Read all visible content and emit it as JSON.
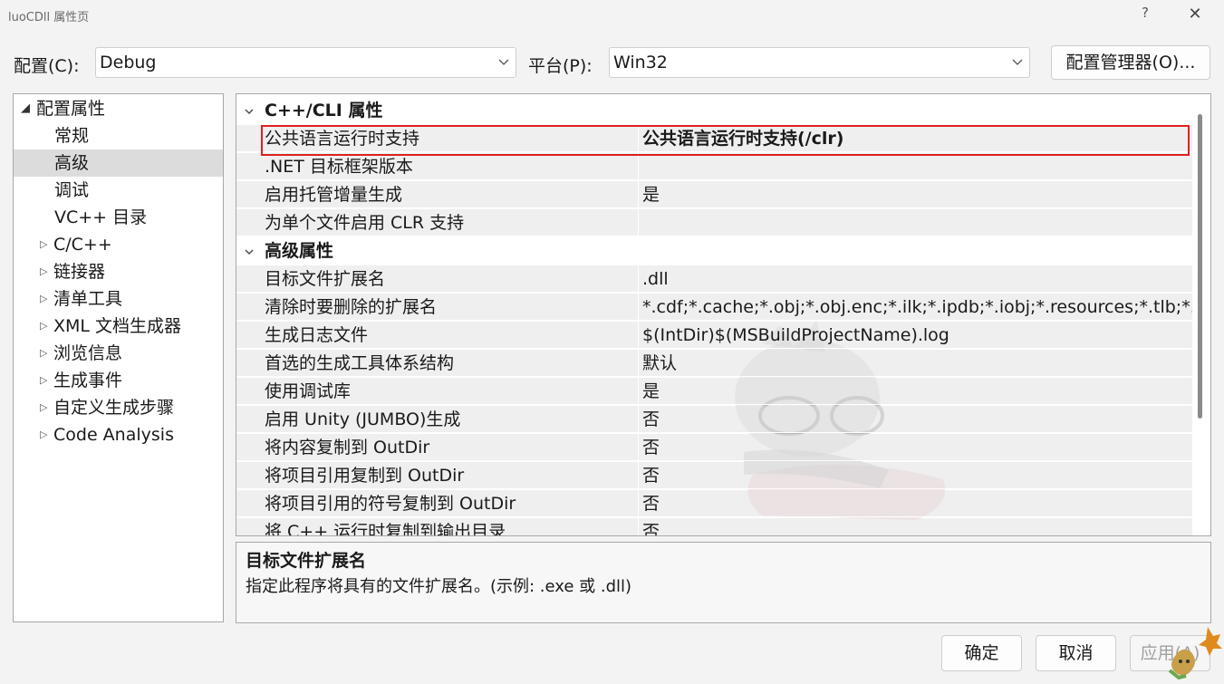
{
  "window": {
    "title": "luoCDll 属性页",
    "help_label": "?",
    "close_label": "✕"
  },
  "config": {
    "config_label": "配置(C):",
    "config_value": "Debug",
    "platform_label": "平台(P):",
    "platform_value": "Win32",
    "manager_button": "配置管理器(O)..."
  },
  "tree": {
    "root": "配置属性",
    "items": [
      {
        "label": "常规",
        "expandable": false
      },
      {
        "label": "高级",
        "expandable": false,
        "selected": true
      },
      {
        "label": "调试",
        "expandable": false
      },
      {
        "label": "VC++ 目录",
        "expandable": false
      },
      {
        "label": "C/C++",
        "expandable": true
      },
      {
        "label": "链接器",
        "expandable": true
      },
      {
        "label": "清单工具",
        "expandable": true
      },
      {
        "label": "XML 文档生成器",
        "expandable": true
      },
      {
        "label": "浏览信息",
        "expandable": true
      },
      {
        "label": "生成事件",
        "expandable": true
      },
      {
        "label": "自定义生成步骤",
        "expandable": true
      },
      {
        "label": "Code Analysis",
        "expandable": true
      }
    ]
  },
  "grid": {
    "sections": [
      {
        "title": "C++/CLI 属性",
        "rows": [
          {
            "name": "公共语言运行时支持",
            "value": "公共语言运行时支持(/clr)",
            "bold": true
          },
          {
            "name": ".NET 目标框架版本",
            "value": ""
          },
          {
            "name": "启用托管增量生成",
            "value": "是"
          },
          {
            "name": "为单个文件启用 CLR 支持",
            "value": ""
          }
        ]
      },
      {
        "title": "高级属性",
        "rows": [
          {
            "name": "目标文件扩展名",
            "value": ".dll"
          },
          {
            "name": "清除时要删除的扩展名",
            "value": "*.cdf;*.cache;*.obj;*.obj.enc;*.ilk;*.ipdb;*.iobj;*.resources;*.tlb;*.tli;"
          },
          {
            "name": "生成日志文件",
            "value": "$(IntDir)$(MSBuildProjectName).log"
          },
          {
            "name": "首选的生成工具体系结构",
            "value": "默认"
          },
          {
            "name": "使用调试库",
            "value": "是"
          },
          {
            "name": "启用 Unity (JUMBO)生成",
            "value": "否"
          },
          {
            "name": "将内容复制到 OutDir",
            "value": "否"
          },
          {
            "name": "将项目引用复制到 OutDir",
            "value": "否"
          },
          {
            "name": "将项目引用的符号复制到 OutDir",
            "value": "否"
          },
          {
            "name": "将 C++ 运行时复制到输出目录",
            "value": "否"
          }
        ]
      }
    ]
  },
  "description": {
    "title": "目标文件扩展名",
    "text": "指定此程序将具有的文件扩展名。(示例: .exe 或 .dll)"
  },
  "buttons": {
    "ok": "确定",
    "cancel": "取消",
    "apply": "应用(A)"
  }
}
